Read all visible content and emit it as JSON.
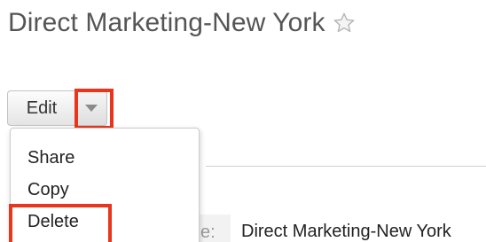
{
  "record": {
    "title": "Direct Marketing-New York",
    "favorite_icon": "star-outline-icon"
  },
  "actions": {
    "edit_label": "Edit",
    "dropdown_icon": "caret-down-icon"
  },
  "menu": {
    "items": [
      {
        "label": "Share"
      },
      {
        "label": "Copy"
      },
      {
        "label": "Delete"
      }
    ]
  },
  "detail": {
    "label_fragment": "e:",
    "value": "Direct Marketing-New York"
  },
  "colors": {
    "highlight": "#e8351b",
    "title_text": "#555555"
  }
}
